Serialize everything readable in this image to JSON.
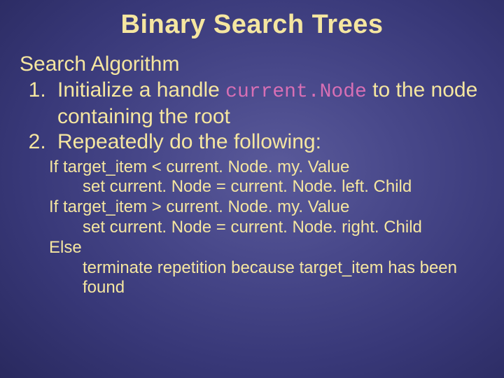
{
  "title": "Binary Search Trees",
  "subtitle": "Search Algorithm",
  "steps": {
    "0": {
      "pre": "Initialize a handle ",
      "code": "current.Node",
      "post": "  to the node containing the root"
    },
    "1": {
      "text": "Repeatedly do the following:"
    }
  },
  "pseudo": {
    "l0": "If target_item < current. Node. my. Value",
    "l1": "set current. Node = current. Node. left. Child",
    "l2": "If target_item > current. Node. my. Value",
    "l3": "set current. Node = current. Node. right. Child",
    "l4": "Else",
    "l5": "terminate repetition because target_item has been found"
  }
}
